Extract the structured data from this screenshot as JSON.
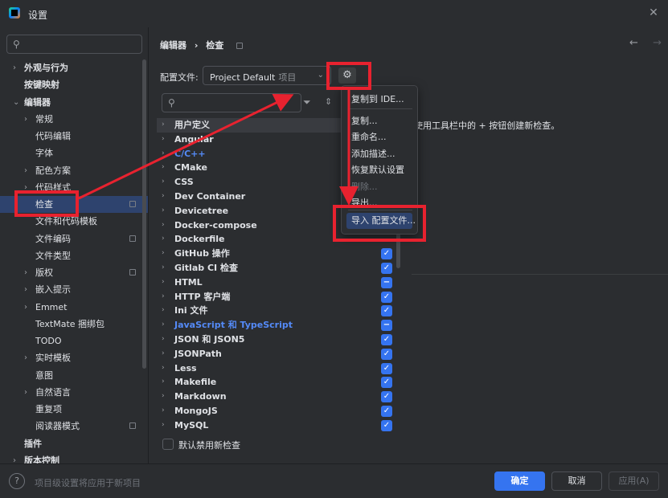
{
  "window": {
    "title": "设置",
    "close_icon": "close-icon"
  },
  "sidebar": {
    "search_placeholder": "",
    "items": [
      {
        "label": "外观与行为",
        "chev": "›",
        "bold": true,
        "level": 0
      },
      {
        "label": "按键映射",
        "chev": "",
        "bold": true,
        "level": 0
      },
      {
        "label": "编辑器",
        "chev": "⌄",
        "bold": true,
        "level": 0
      },
      {
        "label": "常规",
        "chev": "›",
        "bold": false,
        "level": 1
      },
      {
        "label": "代码编辑",
        "chev": "",
        "bold": false,
        "level": 1
      },
      {
        "label": "字体",
        "chev": "",
        "bold": false,
        "level": 1
      },
      {
        "label": "配色方案",
        "chev": "›",
        "bold": false,
        "level": 1
      },
      {
        "label": "代码样式",
        "chev": "›",
        "bold": false,
        "level": 1
      },
      {
        "label": "检查",
        "chev": "",
        "bold": false,
        "level": 1,
        "selected": true,
        "proj": true
      },
      {
        "label": "文件和代码模板",
        "chev": "",
        "bold": false,
        "level": 1
      },
      {
        "label": "文件编码",
        "chev": "",
        "bold": false,
        "level": 1,
        "proj": true
      },
      {
        "label": "文件类型",
        "chev": "",
        "bold": false,
        "level": 1
      },
      {
        "label": "版权",
        "chev": "›",
        "bold": false,
        "level": 1,
        "proj": true
      },
      {
        "label": "嵌入提示",
        "chev": "›",
        "bold": false,
        "level": 1
      },
      {
        "label": "Emmet",
        "chev": "›",
        "bold": false,
        "level": 1
      },
      {
        "label": "TextMate 捆绑包",
        "chev": "",
        "bold": false,
        "level": 1
      },
      {
        "label": "TODO",
        "chev": "",
        "bold": false,
        "level": 1
      },
      {
        "label": "实时模板",
        "chev": "›",
        "bold": false,
        "level": 1
      },
      {
        "label": "意图",
        "chev": "",
        "bold": false,
        "level": 1
      },
      {
        "label": "自然语言",
        "chev": "›",
        "bold": false,
        "level": 1
      },
      {
        "label": "重复项",
        "chev": "",
        "bold": false,
        "level": 1
      },
      {
        "label": "阅读器模式",
        "chev": "",
        "bold": false,
        "level": 1,
        "proj": true
      },
      {
        "label": "插件",
        "chev": "",
        "bold": true,
        "level": 0
      },
      {
        "label": "版本控制",
        "chev": "›",
        "bold": true,
        "level": 0
      }
    ]
  },
  "breadcrumb": {
    "parent": "编辑器",
    "sep": "›",
    "current": "检查"
  },
  "nav": {
    "back": "←",
    "forward": "→"
  },
  "profile": {
    "label": "配置文件:",
    "value": "Project Default",
    "sub": "项目",
    "arrow": "⌄",
    "gear_icon": "gear-icon"
  },
  "inspections": {
    "search_placeholder": "",
    "rows": [
      {
        "name": "用户定义",
        "check": "",
        "blue": false
      },
      {
        "name": "Angular",
        "check": "",
        "blue": false
      },
      {
        "name": "C/C++",
        "check": "",
        "blue": true
      },
      {
        "name": "CMake",
        "check": "",
        "blue": false
      },
      {
        "name": "CSS",
        "check": "",
        "blue": false
      },
      {
        "name": "Dev Container",
        "check": "",
        "blue": false
      },
      {
        "name": "Devicetree",
        "check": "",
        "blue": false
      },
      {
        "name": "Docker-compose",
        "check": "",
        "blue": false
      },
      {
        "name": "Dockerfile",
        "check": "",
        "blue": false
      },
      {
        "name": "GitHub 操作",
        "check": "✓",
        "blue": false
      },
      {
        "name": "Gitlab CI 检查",
        "check": "✓",
        "blue": false
      },
      {
        "name": "HTML",
        "check": "−",
        "blue": false
      },
      {
        "name": "HTTP 客户端",
        "check": "✓",
        "blue": false
      },
      {
        "name": "Ini 文件",
        "check": "✓",
        "blue": false
      },
      {
        "name": "JavaScript 和 TypeScript",
        "check": "−",
        "blue": true
      },
      {
        "name": "JSON 和 JSON5",
        "check": "✓",
        "blue": false
      },
      {
        "name": "JSONPath",
        "check": "✓",
        "blue": false
      },
      {
        "name": "Less",
        "check": "✓",
        "blue": false
      },
      {
        "name": "Makefile",
        "check": "✓",
        "blue": false
      },
      {
        "name": "Markdown",
        "check": "✓",
        "blue": false
      },
      {
        "name": "MongoJS",
        "check": "✓",
        "blue": false
      },
      {
        "name": "MySQL",
        "check": "✓",
        "blue": false
      }
    ]
  },
  "right_panel": {
    "description": "使用工具栏中的 + 按钮创建新检查。"
  },
  "default_disable": {
    "label": "默认禁用新检查"
  },
  "gear_menu": {
    "items": [
      {
        "label": "复制到 IDE...",
        "disabled": false
      },
      {
        "label": "复制...",
        "disabled": false
      },
      {
        "label": "重命名...",
        "disabled": false
      },
      {
        "label": "添加描述...",
        "disabled": false
      },
      {
        "label": "恢复默认设置",
        "disabled": false
      },
      {
        "label": "删除...",
        "disabled": true
      },
      {
        "label": "导出...",
        "disabled": false
      },
      {
        "label": "导入 配置文件...",
        "disabled": false,
        "selected": true
      }
    ]
  },
  "footer": {
    "help": "?",
    "hint": "项目级设置将应用于新项目",
    "ok": "确定",
    "cancel": "取消",
    "apply": "应用(A)"
  },
  "colors": {
    "accent": "#3574f0",
    "annotation": "#e8222f",
    "selection": "#2e436e",
    "background": "#2b2d30"
  }
}
